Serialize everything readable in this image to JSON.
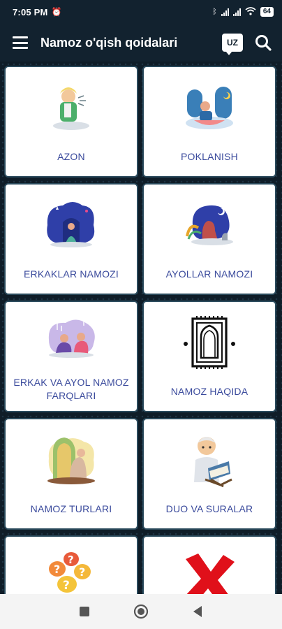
{
  "status": {
    "time": "7:05 PM",
    "battery": "64"
  },
  "appbar": {
    "title": "Namoz o'qish qoidalari",
    "lang": "UZ"
  },
  "cards": [
    {
      "label": "AZON",
      "icon": "azon-icon"
    },
    {
      "label": "POKLANISH",
      "icon": "ablution-icon"
    },
    {
      "label": "ERKAKLAR NAMOZI",
      "icon": "man-praying-icon"
    },
    {
      "label": "AYOLLAR NAMOZI",
      "icon": "woman-praying-icon"
    },
    {
      "label": "ERKAK VA AYOL NAMOZ FARQLARI",
      "icon": "couple-praying-icon"
    },
    {
      "label": "NAMOZ HAQIDA",
      "icon": "prayer-rug-icon"
    },
    {
      "label": "NAMOZ TURLARI",
      "icon": "mosque-prayer-icon"
    },
    {
      "label": "DUO VA SURALAR",
      "icon": "boy-reading-quran-icon"
    },
    {
      "label": "",
      "icon": "question-bubbles-icon"
    },
    {
      "label": "",
      "icon": "red-x-icon"
    }
  ],
  "colors": {
    "appbar": "#12222f",
    "label": "#3a4a9c",
    "accent_red": "#e0101a"
  }
}
